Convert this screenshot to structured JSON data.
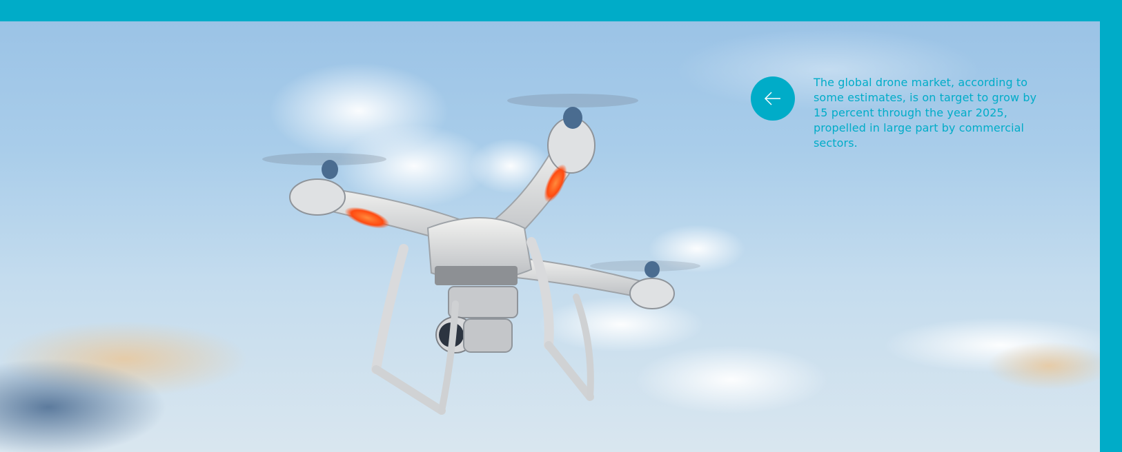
{
  "colors": {
    "brand": "#00acc8",
    "sky_top": "#9bc3e6",
    "sky_bottom": "#d9e6ef",
    "caption_text": "#00acc8"
  },
  "hero": {
    "image_subject": "quadcopter drone flying in blue sky"
  },
  "caption": {
    "icon": "arrow-left-icon",
    "text": "The global drone market, according to some estimates, is on target to grow by 15 percent through the year 2025, propelled in large part by commercial sectors."
  }
}
